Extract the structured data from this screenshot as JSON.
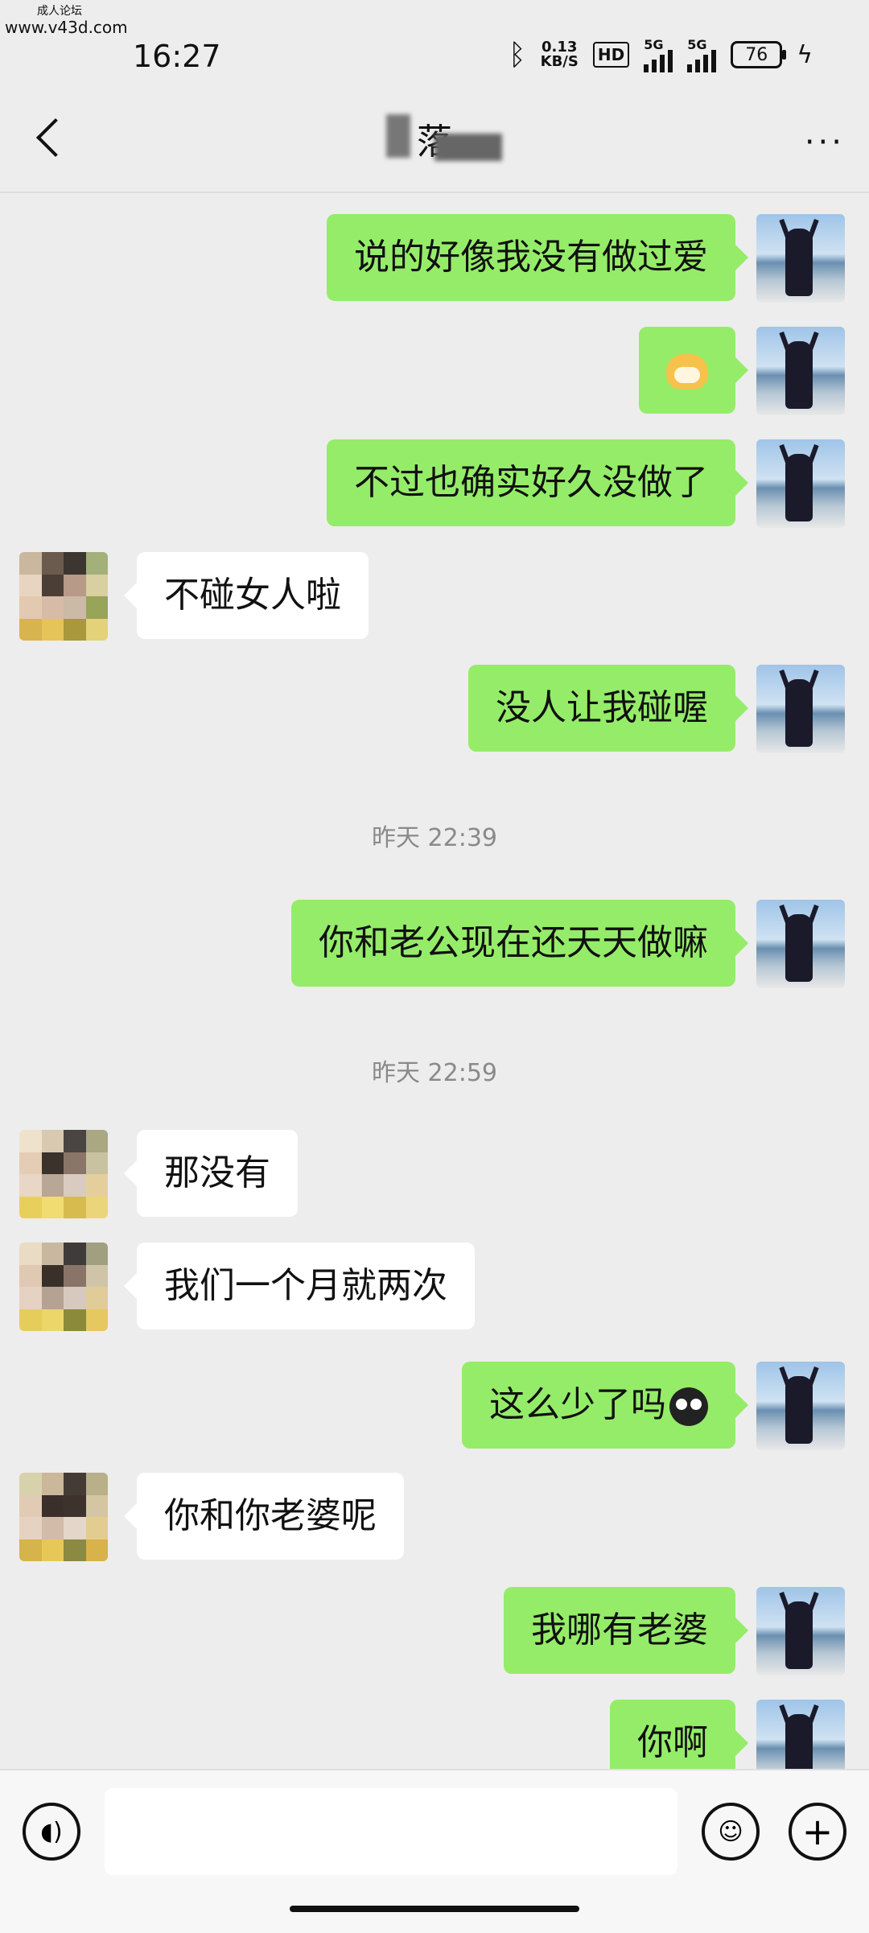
{
  "watermark": {
    "line1": "成人论坛",
    "line2": "www.v43d.com"
  },
  "status_bar": {
    "time": "16:27",
    "net_speed": "0.13",
    "net_unit": "KB/S",
    "hd": "HD",
    "signal1": "5G",
    "signal2": "5G",
    "battery": "76",
    "icons": [
      "bluetooth-icon",
      "charging-icon"
    ]
  },
  "header": {
    "title": "落",
    "more": "···"
  },
  "messages": [
    {
      "text": "说的好像我没有做过爱"
    },
    {
      "text": ""
    },
    {
      "text": "不过也确实好久没做了"
    },
    {
      "text": "不碰女人啦"
    },
    {
      "text": "没人让我碰喔"
    },
    {
      "text": "你和老公现在还天天做嘛"
    },
    {
      "text": "那没有"
    },
    {
      "text": "我们一个月就两次"
    },
    {
      "text": "这么少了吗"
    },
    {
      "text": "你和你老婆呢"
    },
    {
      "text": "我哪有老婆"
    },
    {
      "text": "你啊"
    }
  ],
  "timestamps": [
    "昨天 22:39",
    "昨天 22:59"
  ],
  "colors": {
    "sent_bubble": "#95ec69",
    "received_bubble": "#ffffff",
    "background": "#ededed"
  }
}
